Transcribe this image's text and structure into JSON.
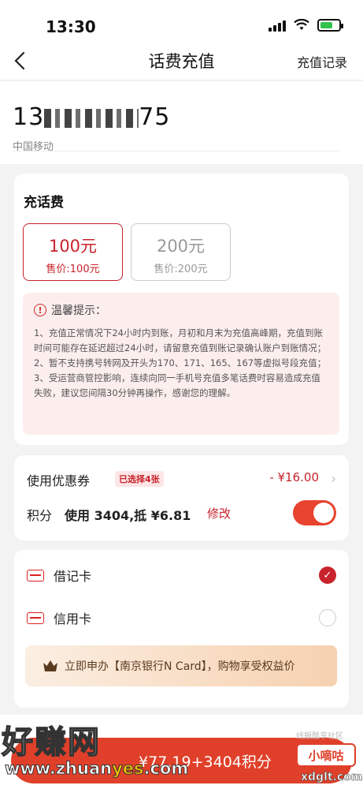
{
  "status_bar": {
    "time": "13:30"
  },
  "nav": {
    "title": "话费充值",
    "right_link": "充值记录"
  },
  "phone": {
    "prefix": "13",
    "suffix": "75",
    "carrier": "中国移动"
  },
  "recharge": {
    "section_title": "充话费",
    "options": [
      {
        "amount": "100元",
        "price": "售价:100元",
        "selected": true
      },
      {
        "amount": "200元",
        "price": "售价:200元",
        "selected": false
      }
    ]
  },
  "notice": {
    "title": "温馨提示：",
    "lines": [
      "1、充值正常情况下24小时内到账，月初和月末为充值高峰期，充值到账时间可能存在延迟超过24小时，请留意充值到账记录确认账户到账情况；",
      "2、暂不支持携号转网及开头为170、171、165、167等虚拟号段充值；",
      "3、受运营商管控影响，连续向同一手机号充值多笔话费时容易造成充值失败，建议您间隔30分钟再操作，感谢您的理解。"
    ]
  },
  "discount": {
    "coupon_label": "使用优惠券",
    "coupon_badge": "已选择4张",
    "coupon_amount": "- ¥16.00",
    "points_label": "积分",
    "points_use": "使用 3404,抵 ¥6.81",
    "points_edit": "修改",
    "points_enabled": true
  },
  "payment": {
    "debit_label": "借记卡",
    "credit_label": "信用卡",
    "selected": "debit",
    "promo_text": "立即申办【南京银行N Card】，购物享受权益价"
  },
  "pay_button": {
    "label": "¥77.19+3404积分"
  },
  "watermark": {
    "left_title": "好赚网",
    "left_url_a": "www.zhuan",
    "left_url_b": "yes",
    "left_url_c": ".com",
    "right_small": "线报酷享社区",
    "right_name": "小嘀咕",
    "right_url": "xdglt.com"
  },
  "colors": {
    "accent": "#c8232c",
    "button": "#e0402a",
    "toggle": "#e8432e"
  }
}
